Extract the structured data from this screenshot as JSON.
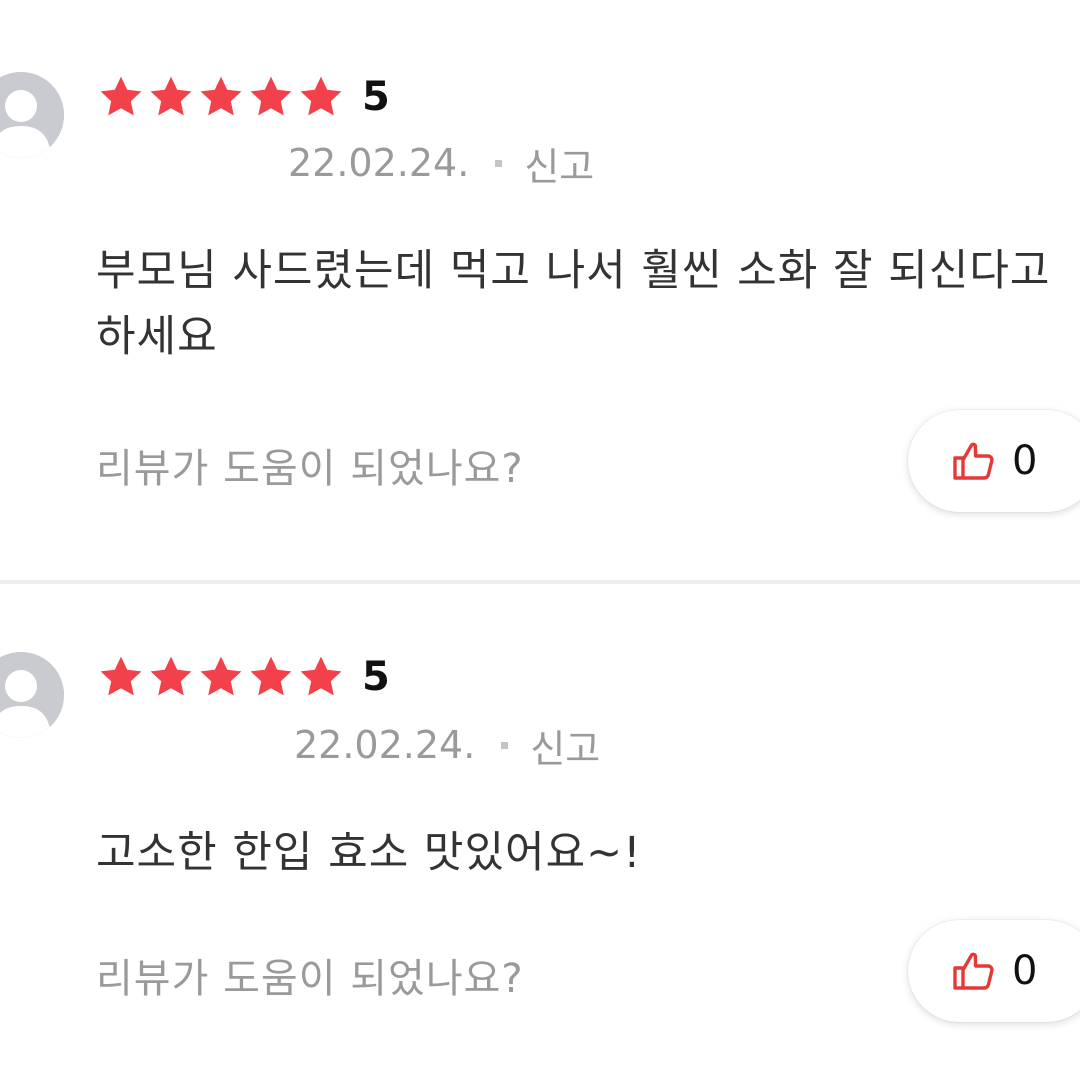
{
  "reviews": [
    {
      "rating": 5,
      "rating_label": "5",
      "date": "22.02.24.",
      "report_label": "신고",
      "text": "부모님 사드렸는데 먹고 나서 훨씬 소화 잘 되신다고 하세요",
      "helpful_question": "리뷰가 도움이 되었나요?",
      "like_count": "0",
      "icons": {
        "avatar": "user-avatar-icon",
        "like": "thumbs-up-icon",
        "star": "star-icon"
      }
    },
    {
      "rating": 5,
      "rating_label": "5",
      "date": "22.02.24.",
      "report_label": "신고",
      "text": "고소한 한입 효소 맛있어요~!",
      "helpful_question": "리뷰가 도움이 되었나요?",
      "like_count": "0",
      "icons": {
        "avatar": "user-avatar-icon",
        "like": "thumbs-up-icon",
        "star": "star-icon"
      }
    }
  ],
  "colors": {
    "star": "#f2414a",
    "like_icon": "#e53935",
    "meta_text": "#9a9a9a",
    "body_text": "#333333"
  }
}
